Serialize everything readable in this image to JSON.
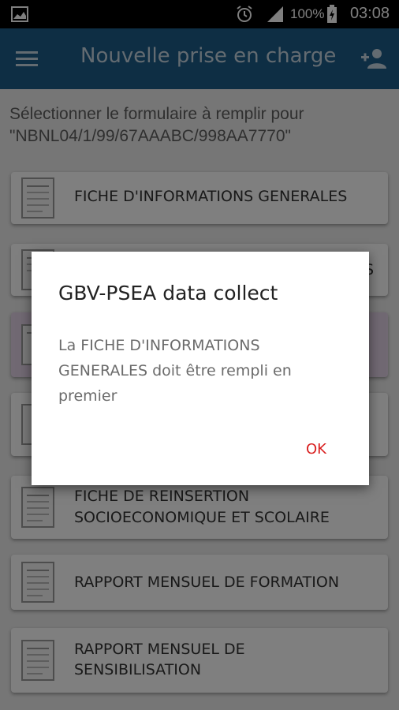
{
  "status_bar": {
    "battery_percent": "100%",
    "time": "03:08",
    "icons": [
      "gallery-icon",
      "alarm-icon",
      "signal-icon",
      "battery-charging-icon"
    ]
  },
  "app_bar": {
    "title": "Nouvelle prise en charge",
    "menu_icon": "hamburger-menu-icon",
    "action_icon": "add-person-icon"
  },
  "prompt": {
    "line1": "Sélectionner le formulaire à remplir pour",
    "line2": "\"NBNL04/1/99/67AAABC/998AA7770\""
  },
  "forms": [
    {
      "line1": "FICHE D'INFORMATIONS GENERALES",
      "line2": ""
    },
    {
      "line1": "S",
      "line2": ""
    },
    {
      "line1": "",
      "line2": ""
    },
    {
      "line1": "",
      "line2": ""
    },
    {
      "line1": "FICHE DE REINSERTION",
      "line2": "SOCIOECONOMIQUE ET SCOLAIRE"
    },
    {
      "line1": "RAPPORT MENSUEL DE FORMATION",
      "line2": ""
    },
    {
      "line1": "RAPPORT MENSUEL DE",
      "line2": "SENSIBILISATION"
    }
  ],
  "dialog": {
    "title": "GBV-PSEA data collect",
    "message": "La FICHE D'INFORMATIONS GENERALES doit être rempli en premier",
    "ok_label": "OK"
  },
  "colors": {
    "app_bar": "#1d5c88",
    "dialog_button": "#d91f1f",
    "highlight_card": "#e2d2e7"
  }
}
